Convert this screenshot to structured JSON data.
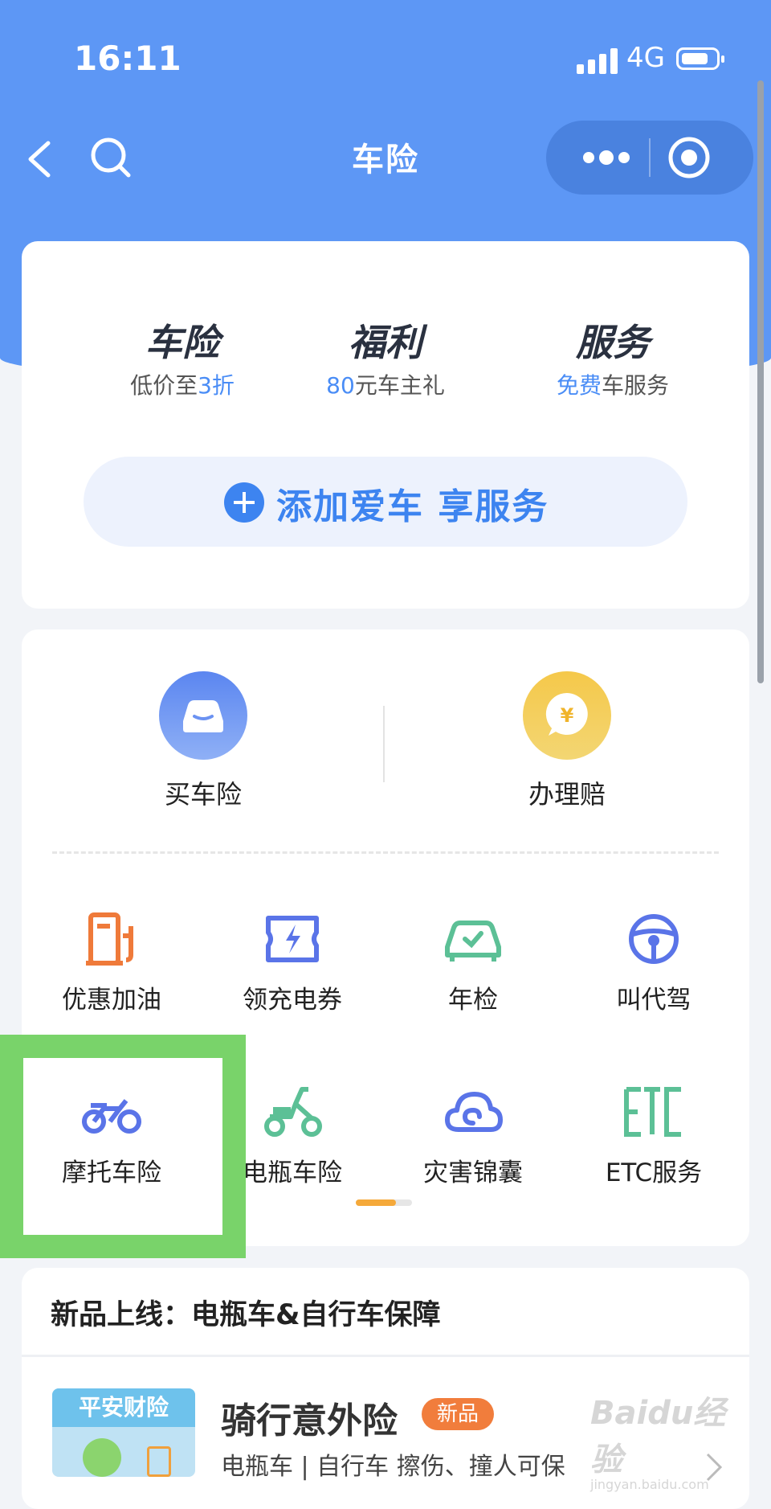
{
  "status_bar": {
    "time": "16:11",
    "network": "4G"
  },
  "navbar": {
    "title": "车险"
  },
  "promos": [
    {
      "title": "车险",
      "sub_prefix": "低价至",
      "sub_highlight": "3折",
      "sub_suffix": ""
    },
    {
      "title": "福利",
      "sub_prefix": "",
      "sub_highlight": "80",
      "sub_suffix": "元车主礼"
    },
    {
      "title": "服务",
      "sub_prefix": "",
      "sub_highlight": "免费",
      "sub_suffix": "车服务"
    }
  ],
  "add_car": {
    "label": "添加爱车 享服务"
  },
  "main_actions": [
    {
      "label": "买车险",
      "icon": "car-icon"
    },
    {
      "label": "办理赔",
      "icon": "yen-bubble-icon"
    }
  ],
  "services": [
    {
      "label": "优惠加油",
      "icon": "fuel-pump-icon"
    },
    {
      "label": "领充电券",
      "icon": "charge-coupon-icon"
    },
    {
      "label": "年检",
      "icon": "inspection-car-icon"
    },
    {
      "label": "叫代驾",
      "icon": "steering-wheel-icon"
    },
    {
      "label": "摩托车险",
      "icon": "motorcycle-icon"
    },
    {
      "label": "电瓶车险",
      "icon": "scooter-icon"
    },
    {
      "label": "灾害锦囊",
      "icon": "cloud-icon"
    },
    {
      "label": "ETC服务",
      "icon": "etc-icon"
    }
  ],
  "pager": {
    "pages": 2,
    "current": 1
  },
  "new_products": {
    "title": "新品上线：电瓶车&自行车保障",
    "item": {
      "thumb_tag": "平安财险",
      "title": "骑行意外险",
      "badge": "新品",
      "subtitle": "电瓶车 | 自行车 擦伤、撞人可保"
    }
  },
  "watermark": {
    "line1": "Baidu经验",
    "line2": "jingyan.baidu.com"
  },
  "colors": {
    "header": "#5d97f5",
    "accent": "#3d84f0",
    "highlight": "#79d36a",
    "orange": "#ef7a3a",
    "green": "#5cc096",
    "indigo": "#5a74e8"
  }
}
